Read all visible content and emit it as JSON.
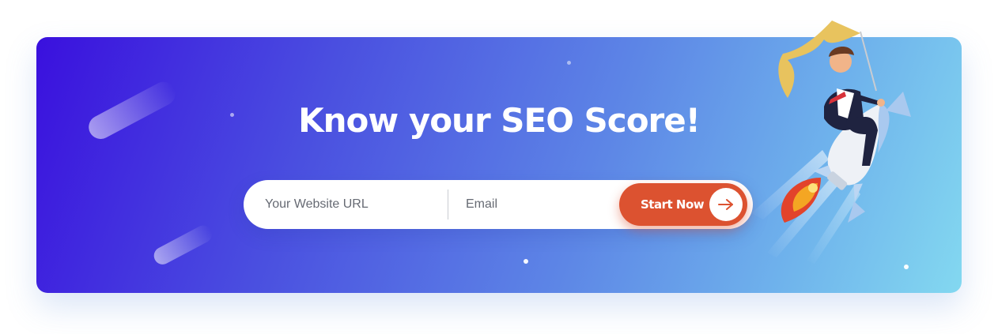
{
  "hero": {
    "title": "Know your SEO Score!"
  },
  "form": {
    "url_placeholder": "Your Website URL",
    "email_placeholder": "Email",
    "submit_label": "Start Now"
  },
  "icons": {
    "submit_icon": "arrow-right-icon",
    "illustration": "rocket-rider-with-flag"
  },
  "colors": {
    "gradient_start": "#3a10de",
    "gradient_end": "#83d8f0",
    "button": "#dc5230",
    "text_on_banner": "#ffffff"
  }
}
